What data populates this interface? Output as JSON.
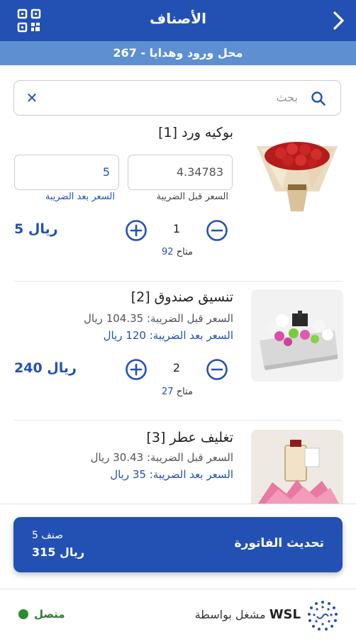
{
  "header": {
    "title": "الأصناف",
    "store": "267 - محل ورود وهدايا"
  },
  "search": {
    "placeholder": "بحث",
    "clear": "✕"
  },
  "items": [
    {
      "name": "[1] بوكيه ورد",
      "price_before_tax_value": "4.34783",
      "price_after_tax_value": "5",
      "price_before_tax_label": "السعر قبل الضريبة",
      "price_after_tax_label": "السعر بعد الضريبة",
      "quantity": "1",
      "total": "5 ريال",
      "available_label": "متاح",
      "available_value": "92"
    },
    {
      "name": "[2] تنسيق صندوق",
      "price_before_tax_text": "السعر قبل الضريبة: 104.35 ريال",
      "price_after_tax_text": "السعر بعد الضريبة: 120 ريال",
      "quantity": "2",
      "total": "240 ريال",
      "available_label": "متاح",
      "available_value": "27"
    },
    {
      "name": "[3] تغليف عطر",
      "price_before_tax_text": "السعر قبل الضريبة: 30.43 ريال",
      "price_after_tax_text": "السعر بعد الضريبة: 35 ريال"
    }
  ],
  "invoice": {
    "count": "5 صنف",
    "sum": "315 ريال",
    "update_label": "تحديث الفاتورة"
  },
  "footer": {
    "status": "متصل",
    "powered_by": "مشغل بواسطة",
    "brand": "WSL"
  },
  "colors": {
    "primary": "#2351b3",
    "subheader": "#5d8fd1",
    "status_green": "#2e8b2e"
  }
}
